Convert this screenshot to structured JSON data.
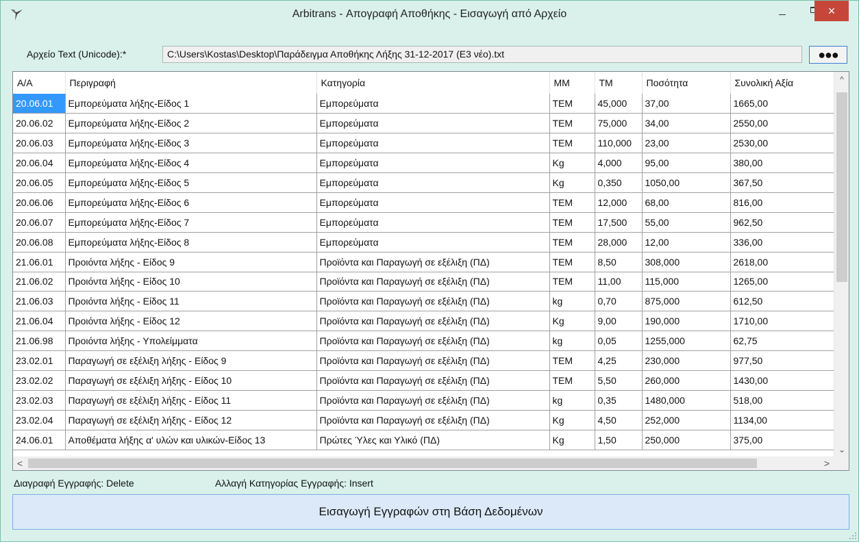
{
  "window": {
    "title": "Arbitrans - Απογραφή Αποθήκης - Εισαγωγή από Αρχείο",
    "close_glyph": "×"
  },
  "file": {
    "label": "Αρχείο Text (Unicode):*",
    "path": "C:\\Users\\Kostas\\Desktop\\Παράδειγμα Αποθήκης Λήξης 31-12-2017 (E3 νέο).txt",
    "browse_label": "●●●"
  },
  "grid": {
    "columns": [
      "Α/Α",
      "Περιγραφή",
      "Κατηγορία",
      "ΜΜ",
      "ΤΜ",
      "Ποσότητα",
      "Συνολική Αξία"
    ],
    "rows": [
      [
        "20.06.01",
        "Εμπορεύματα λήξης-Είδος 1",
        "Εμπορεύματα",
        "TEM",
        "45,000",
        "37,00",
        "1665,00"
      ],
      [
        "20.06.02",
        "Εμπορεύματα λήξης-Είδος 2",
        "Εμπορεύματα",
        "TEM",
        "75,000",
        "34,00",
        "2550,00"
      ],
      [
        "20.06.03",
        "Εμπορεύματα λήξης-Είδος 3",
        "Εμπορεύματα",
        "TEM",
        "110,000",
        "23,00",
        "2530,00"
      ],
      [
        "20.06.04",
        "Εμπορεύματα λήξης-Είδος 4",
        "Εμπορεύματα",
        "Kg",
        "4,000",
        "95,00",
        "380,00"
      ],
      [
        "20.06.05",
        "Εμπορεύματα λήξης-Είδος 5",
        "Εμπορεύματα",
        "Kg",
        "0,350",
        "1050,00",
        "367,50"
      ],
      [
        "20.06.06",
        "Εμπορεύματα λήξης-Είδος 6",
        "Εμπορεύματα",
        "TEM",
        "12,000",
        "68,00",
        "816,00"
      ],
      [
        "20.06.07",
        "Εμπορεύματα λήξης-Είδος 7",
        "Εμπορεύματα",
        "TEM",
        "17,500",
        "55,00",
        "962,50"
      ],
      [
        "20.06.08",
        "Εμπορεύματα λήξης-Είδος 8",
        "Εμπορεύματα",
        "TEM",
        "28,000",
        "12,00",
        "336,00"
      ],
      [
        "21.06.01",
        "Προιόντα λήξης - Είδος 9",
        "Προϊόντα και Παραγωγή σε εξέλιξη (ΠΔ)",
        "TEM",
        "8,50",
        "308,000",
        "2618,00"
      ],
      [
        "21.06.02",
        "Προιόντα λήξης - Είδος 10",
        "Προϊόντα και Παραγωγή σε εξέλιξη (ΠΔ)",
        "TEM",
        "11,00",
        "115,000",
        "1265,00"
      ],
      [
        "21.06.03",
        "Προιόντα λήξης - Είδος 11",
        "Προϊόντα και Παραγωγή σε εξέλιξη (ΠΔ)",
        "kg",
        "0,70",
        "875,000",
        "612,50"
      ],
      [
        "21.06.04",
        "Προιόντα λήξης - Είδος 12",
        "Προϊόντα και Παραγωγή σε εξέλιξη (ΠΔ)",
        "Kg",
        "9,00",
        "190,000",
        "1710,00"
      ],
      [
        "21.06.98",
        "Προιόντα λήξης - Υπολείμματα",
        "Προϊόντα και Παραγωγή σε εξέλιξη (ΠΔ)",
        "kg",
        "0,05",
        "1255,000",
        "62,75"
      ],
      [
        "23.02.01",
        "Παραγωγή σε εξέλιξη λήξης - Είδος 9",
        "Προϊόντα και Παραγωγή σε εξέλιξη (ΠΔ)",
        "TEM",
        "4,25",
        "230,000",
        "977,50"
      ],
      [
        "23.02.02",
        "Παραγωγή σε εξέλιξη λήξης - Είδος 10",
        "Προϊόντα και Παραγωγή σε εξέλιξη (ΠΔ)",
        "TEM",
        "5,50",
        "260,000",
        "1430,00"
      ],
      [
        "23.02.03",
        "Παραγωγή σε εξέλιξη λήξης - Είδος 11",
        "Προϊόντα και Παραγωγή σε εξέλιξη (ΠΔ)",
        "kg",
        "0,35",
        "1480,000",
        "518,00"
      ],
      [
        "23.02.04",
        "Παραγωγή σε εξέλιξη λήξης - Είδος 12",
        "Προϊόντα και Παραγωγή σε εξέλιξη (ΠΔ)",
        "Kg",
        "4,50",
        "252,000",
        "1134,00"
      ],
      [
        "24.06.01",
        "Αποθέματα λήξης α' υλών και υλικών-Είδος 13",
        "Πρώτες Ύλες και Υλικό (ΠΔ)",
        "Kg",
        "1,50",
        "250,000",
        "375,00"
      ]
    ]
  },
  "hints": {
    "delete": "Διαγραφή Εγγραφής: Delete",
    "insert": "Αλλαγή Κατηγορίας Εγγραφής: Insert"
  },
  "import_button": "Εισαγωγή Εγγραφών στη Βάση Δεδομένων",
  "colors": {
    "window_bg": "#d9f1ea",
    "selection": "#3399ff",
    "close_button": "#c7463a",
    "import_button_bg": "#dbe9f8"
  }
}
